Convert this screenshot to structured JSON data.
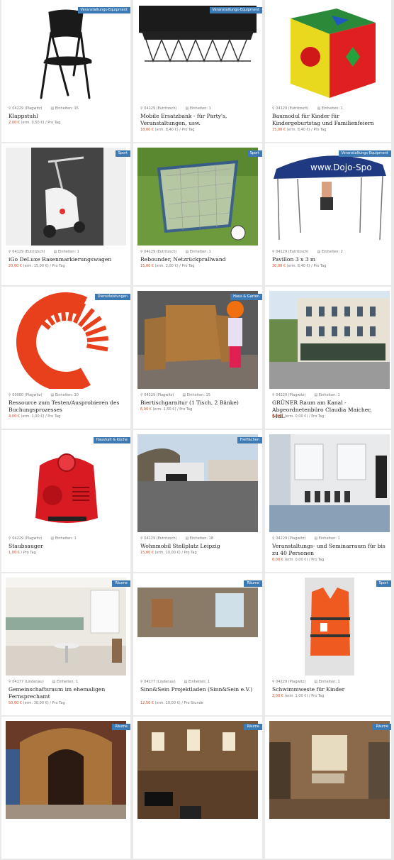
{
  "listings": [
    {
      "badge": "Veranstaltungs-Equipment",
      "location": "04229 (Plagwitz)",
      "units": "Einheiten: 15",
      "title": "Klappstuhl",
      "price": "2,00 €",
      "price_detail": " (erm. 0,50 €) / Pro Tag",
      "icon": "folding-chair"
    },
    {
      "badge": "Veranstaltungs-Equipment",
      "location": "04129 (Eutritzsch)",
      "units": "Einheiten: 1",
      "title": "Mobile Ersatzbank - für Party's, Veranstaltungen, usw.",
      "price": "18,00 €",
      "price_detail": " (erm. 8,40 €) / Pro Tag",
      "icon": "bench"
    },
    {
      "badge": "",
      "location": "04129 (Eutritzsch)",
      "units": "Einheiten: 1",
      "title": "Baumodul für Kinder für Kindergeburtstag und Familienfeiern",
      "price": "15,00 €",
      "price_detail": " (erm. 8,40 €) / Pro Tag",
      "icon": "foam-cube"
    },
    {
      "badge": "Sport",
      "location": "04129 (Eutritzsch)",
      "units": "Einheiten: 1",
      "title": "iGo DeLuxe Rasenmarkierungswagen",
      "price": "20,00 €",
      "price_detail": " (erm. 15,00 €) / Pro Tag",
      "icon": "line-marker"
    },
    {
      "badge": "Sport",
      "location": "04129 (Eutritzsch)",
      "units": "Einheiten: 1",
      "title": "Rebounder, Netzrückprallwand",
      "price": "15,00 €",
      "price_detail": " (erm. 2,00 €) / Pro Tag",
      "icon": "rebounder"
    },
    {
      "badge": "Veranstaltungs-Equipment",
      "location": "04129 (Eutritzsch)",
      "units": "Einheiten: 2",
      "title": "Pavillon 3 x 3 m",
      "price": "30,00 €",
      "price_detail": " (erm. 8,40 €) / Pro Tag",
      "icon": "pavilion"
    },
    {
      "badge": "Dienstleistungen",
      "location": "00000 (Plagwitz)",
      "units": "Einheiten: 10",
      "title": "Ressource zum Testen/Ausprobieren des Buchungsprozesses",
      "price": "4,00 €",
      "price_detail": " (erm. 1,00 €) / Pro Tag",
      "icon": "logo"
    },
    {
      "badge": "Haus & Garten",
      "location": "04229 (Plagwitz)",
      "units": "Einheiten: 15",
      "title": "Biertischgarnitur (1 Tisch, 2 Bänke)",
      "price": "6,00 €",
      "price_detail": " (erm. 1,50 €) / Pro Tag",
      "icon": "beer-table"
    },
    {
      "badge": "",
      "location": "04229 (Plagwitz)",
      "units": "Einheiten: 1",
      "title": "GRÜNER Raum am Kanal - Abgeordnetenbüro Claudia Maicher, MdL",
      "price": "0,00 €",
      "price_detail": " (erm. 0,00 €) / Pro Tag",
      "icon": "building"
    },
    {
      "badge": "Haushalt & Küche",
      "location": "04229 (Plagwitz)",
      "units": "Einheiten: 1",
      "title": "Staubsauger",
      "price": "1,00 €",
      "price_detail": " / Pro Tag",
      "icon": "vacuum"
    },
    {
      "badge": "Freiflächen",
      "location": "04129 (Eutritzsch)",
      "units": "Einheiten: 18",
      "title": "Wohnmobil Stellplatz Leipzig",
      "price": "15,00 €",
      "price_detail": " (erm. 10,00 €) / Pro Tag",
      "icon": "parking"
    },
    {
      "badge": "",
      "location": "04229 (Plagwitz)",
      "units": "Einheiten: 1",
      "title": "Veranstaltungs- und Seminarraum für bis zu 40 Personen",
      "price": "0,00 €",
      "price_detail": " (erm. 0,00 €) / Pro Tag",
      "icon": "seminar-room"
    },
    {
      "badge": "Räume",
      "location": "04177 (Lindenau)",
      "units": "Einheiten: 1",
      "title": "Gemeinschaftsraum im ehemaligen Fernsprechamt",
      "price": "50,00 €",
      "price_detail": " (erm. 30,00 €) / Pro Tag",
      "icon": "community-room"
    },
    {
      "badge": "Räume",
      "location": "04177 (Lindenau)",
      "units": "Einheiten: 1",
      "title": "Sinn&Sein Projektladen (Sinn&Sein e.V.)",
      "price": "12,50 €",
      "price_detail": " (erm. 10,00 €) / Pro Stunde",
      "icon": "shop-pano"
    },
    {
      "badge": "Sport",
      "location": "04229 (Plagwitz)",
      "units": "Einheiten: 1",
      "title": "Schwimmweste für Kinder",
      "price": "2,00 €",
      "price_detail": " (erm. 1,00 €) / Pro Tag",
      "icon": "life-vest"
    },
    {
      "badge": "Räume",
      "location": "",
      "units": "",
      "title": "",
      "price": "",
      "price_detail": "",
      "icon": "hall-ornate"
    },
    {
      "badge": "Räume",
      "location": "",
      "units": "",
      "title": "",
      "price": "",
      "price_detail": "",
      "icon": "hall-piano"
    },
    {
      "badge": "Räume",
      "location": "",
      "units": "",
      "title": "",
      "price": "",
      "price_detail": "",
      "icon": "hall-tables"
    }
  ],
  "colors": {
    "accent": "#3d7ab3",
    "price": "#d9481d"
  }
}
